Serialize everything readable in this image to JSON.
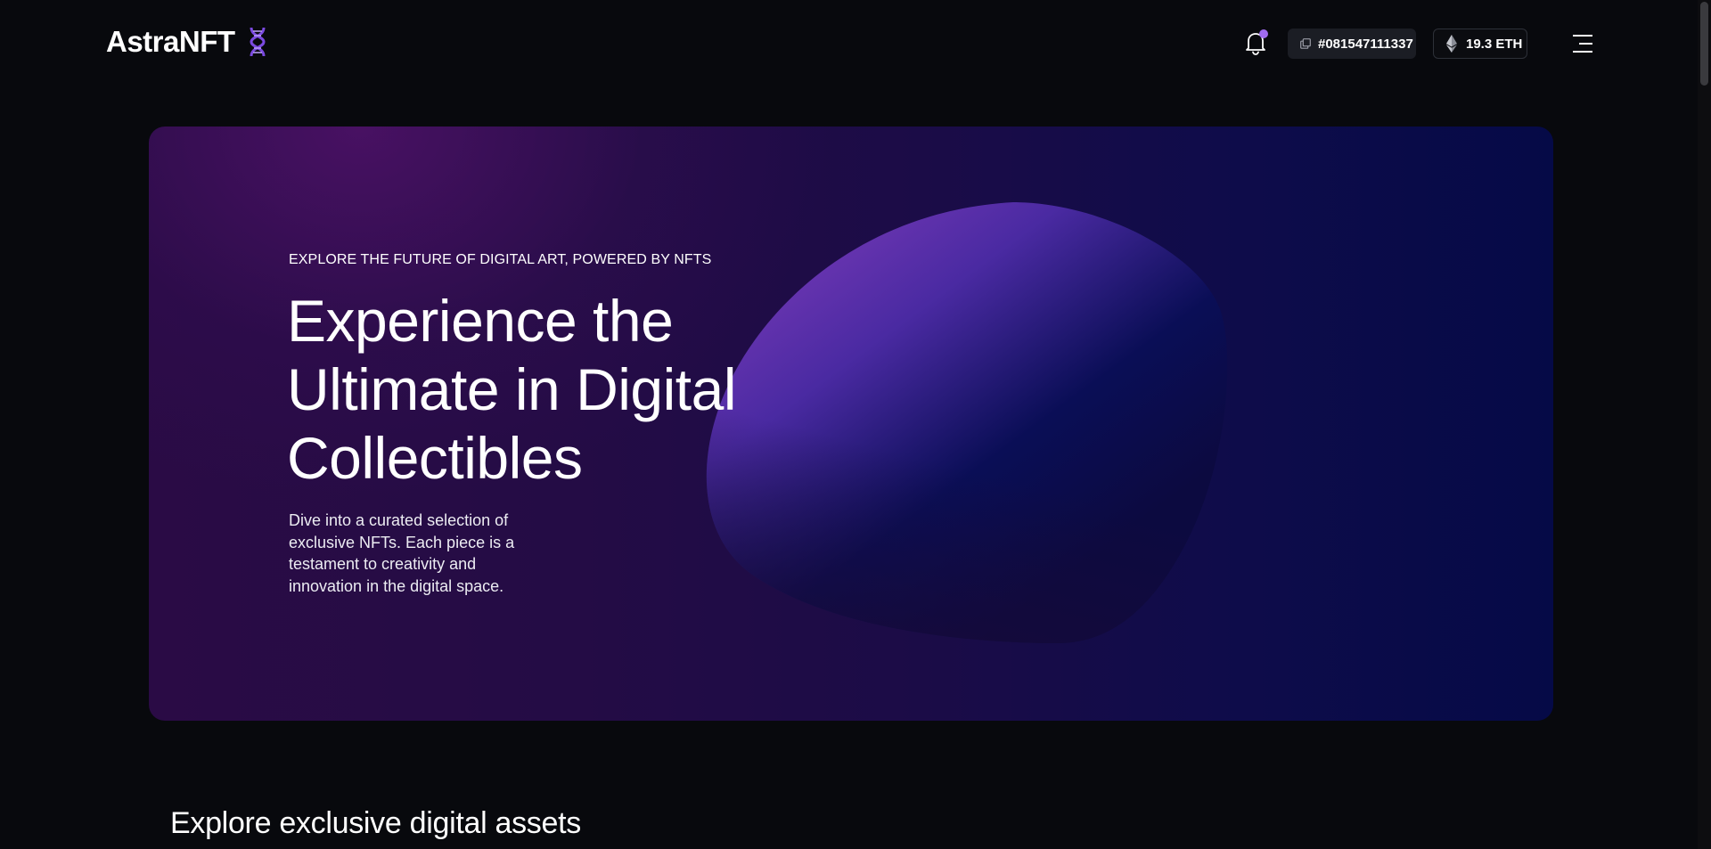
{
  "brand": {
    "name": "AstraNFT",
    "icon": "dna-icon",
    "accent": "#7b4ae0"
  },
  "header": {
    "notification_icon": "bell-icon",
    "address": "#081547111337",
    "copy_icon": "copy-icon",
    "balance": "19.3 ETH",
    "eth_icon": "ethereum-icon",
    "menu_icon": "menu-icon"
  },
  "hero": {
    "eyebrow": "EXPLORE THE FUTURE OF DIGITAL ART, POWERED BY NFTS",
    "title_lines": [
      "Experience the",
      "Ultimate in Digital",
      "Collectibles"
    ],
    "description": "Dive into a curated selection of exclusive NFTs. Each piece is a testament to creativity and innovation in the digital space."
  },
  "section": {
    "title": "Explore exclusive digital assets"
  }
}
